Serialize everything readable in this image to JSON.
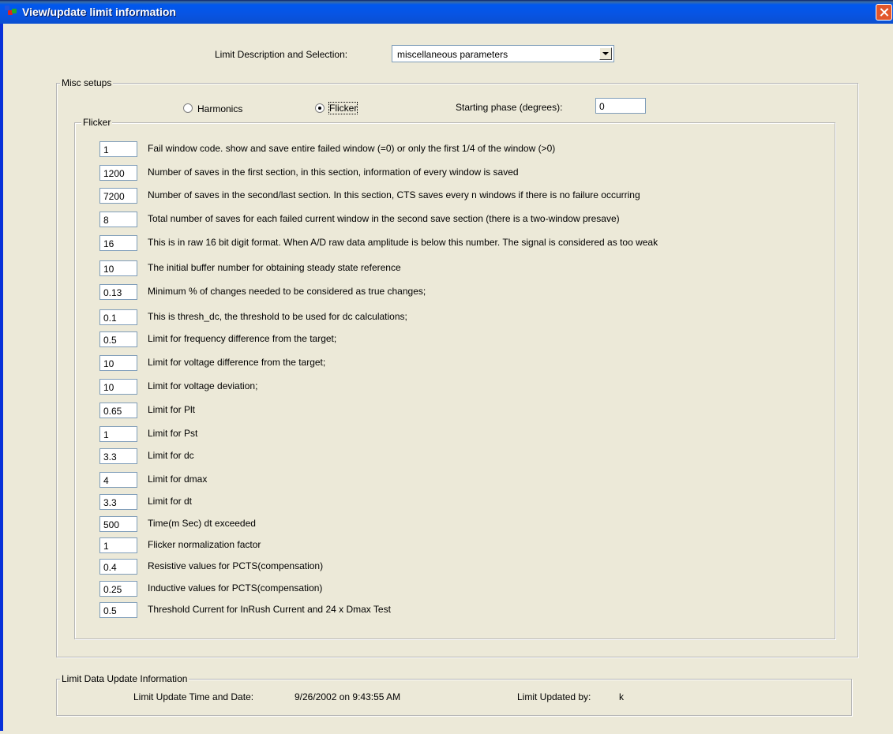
{
  "window": {
    "title": "View/update limit information",
    "colors": {
      "titlebar": "#0854E3",
      "close": "#E2562B",
      "face": "#ECE9D8"
    }
  },
  "selection": {
    "label": "Limit Description and Selection:",
    "value": "miscellaneous parameters"
  },
  "misc": {
    "group_label": "Misc setups",
    "radio_harmonics": "Harmonics",
    "radio_flicker": "Flicker",
    "selected": "Flicker",
    "starting_phase_label": "Starting phase (degrees):",
    "starting_phase_value": "0"
  },
  "flicker": {
    "group_label": "Flicker",
    "rows": [
      {
        "value": "1",
        "label": "Fail window code. show and save entire failed window (=0) or only the first 1/4 of the window (>0)"
      },
      {
        "value": "1200",
        "label": "Number of saves in the first section, in this section, information of every window is saved"
      },
      {
        "value": "7200",
        "label": "Number of saves in the second/last section.  In this section, CTS saves every n windows if there is no failure occurring"
      },
      {
        "value": "8",
        "label": "Total number of saves for each failed current window in the second save section (there is a two-window presave)"
      },
      {
        "value": "16",
        "label": "This is in raw 16 bit digit format.  When A/D raw data amplitude is below this number.  The signal is considered as too weak"
      },
      {
        "value": "10",
        "label": "The initial buffer number for obtaining steady state reference"
      },
      {
        "value": "0.13",
        "label": "Minimum % of changes needed to be considered as true changes;"
      },
      {
        "value": "0.1",
        "label": "This is thresh_dc, the threshold to be used for dc calculations;"
      },
      {
        "value": "0.5",
        "label": "Limit for frequency difference from the target;"
      },
      {
        "value": "10",
        "label": "Limit for voltage difference from the target;"
      },
      {
        "value": "10",
        "label": "Limit for voltage deviation;"
      },
      {
        "value": "0.65",
        "label": "Limit for Plt"
      },
      {
        "value": "1",
        "label": "Limit for Pst"
      },
      {
        "value": "3.3",
        "label": "Limit for dc"
      },
      {
        "value": "4",
        "label": "Limit for dmax"
      },
      {
        "value": "3.3",
        "label": "Limit for dt"
      },
      {
        "value": "500",
        "label": "Time(m Sec) dt exceeded"
      },
      {
        "value": "1",
        "label": "Flicker normalization factor"
      },
      {
        "value": "0.4",
        "label": "Resistive values for PCTS(compensation)"
      },
      {
        "value": "0.25",
        "label": "Inductive values for PCTS(compensation)"
      },
      {
        "value": "0.5",
        "label": "Threshold Current for InRush Current and 24 x Dmax Test"
      }
    ]
  },
  "update_info": {
    "group_label": "Limit Data Update Information",
    "time_label": "Limit Update Time and Date:",
    "time_value": "9/26/2002 on 9:43:55 AM",
    "by_label": "Limit Updated by:",
    "by_value": "k"
  }
}
